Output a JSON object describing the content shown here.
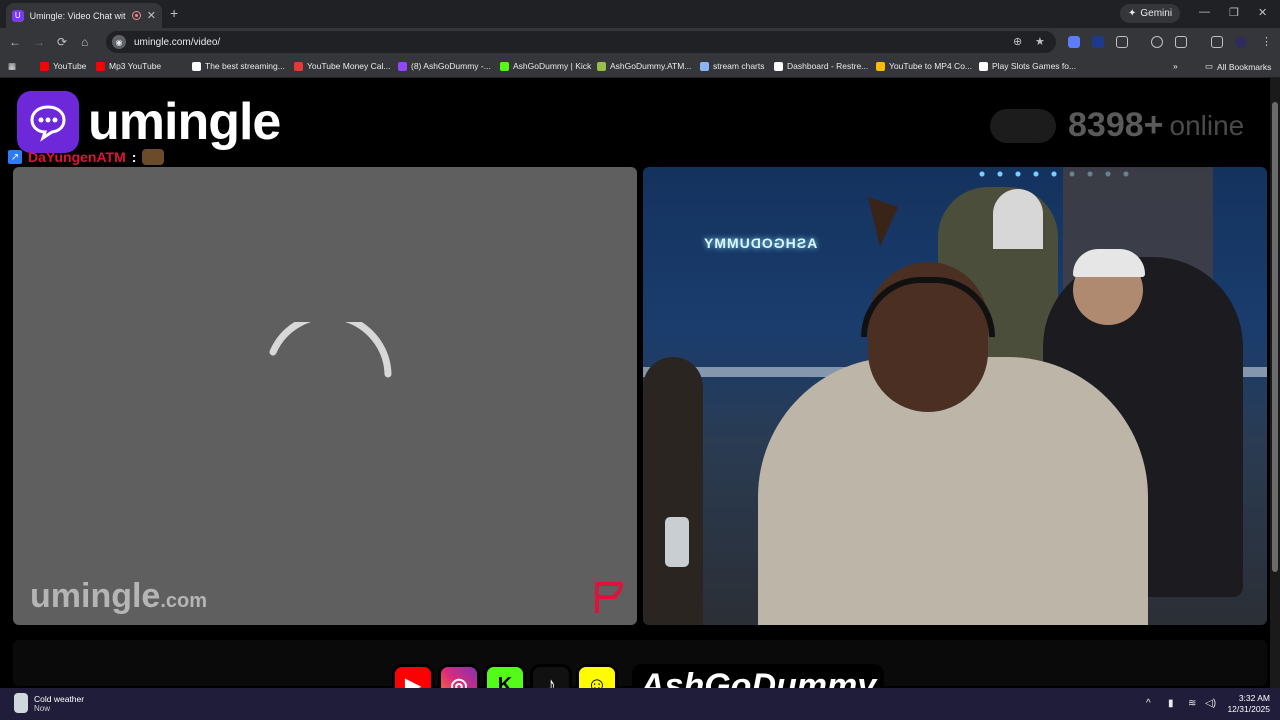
{
  "browser": {
    "tab_title": "Umingle: Video Chat with St",
    "tab_favicon": "U",
    "new_tab_glyph": "+",
    "gemini_label": "Gemini",
    "url": "umingle.com/video/",
    "bookmarks": [
      {
        "label": "YouTube",
        "color": "#ff0000"
      },
      {
        "label": "Mp3 YouTube",
        "color": "#ff0000"
      },
      {
        "label": "The best streaming...",
        "color": "#ffffff"
      },
      {
        "label": "YouTube Money Cal...",
        "color": "#e53935"
      },
      {
        "label": "(8) AshGoDummy -...",
        "color": "#9146ff"
      },
      {
        "label": "AshGoDummy | Kick",
        "color": "#53fc18"
      },
      {
        "label": "AshGoDummy.ATM...",
        "color": "#95bf47"
      },
      {
        "label": "stream charts",
        "color": "#8ab4f8"
      },
      {
        "label": "Dashboard - Restre...",
        "color": "#ffffff"
      },
      {
        "label": "YouTube to MP4 Co...",
        "color": "#fbbc04"
      },
      {
        "label": "Play Slots Games fo...",
        "color": "#ffffff"
      }
    ],
    "all_bookmarks_label": "All Bookmarks",
    "icons": {
      "back": "←",
      "forward": "→",
      "reload": "⟳",
      "home": "⌂",
      "zoom": "⊕",
      "star": "★",
      "more": "⋮",
      "overflow": "»",
      "folder": "▭",
      "apps": "▦"
    }
  },
  "page": {
    "logo_text": "umingle",
    "online_count": "8398+",
    "online_label": "online",
    "chat_user": "DaYungenATM",
    "chat_colon": ":",
    "watermark_main": "umingle",
    "watermark_suffix": ".com",
    "stream_sign_text": "ASHGODUMMY"
  },
  "overlay": {
    "handle": "AshGoDummy",
    "socials": [
      {
        "name": "youtube",
        "glyph": "▶",
        "color": "#ff0000"
      },
      {
        "name": "instagram",
        "glyph": "◎",
        "color": "#c13584"
      },
      {
        "name": "kick",
        "glyph": "K",
        "color": "#53fc18"
      },
      {
        "name": "tiktok",
        "glyph": "♪",
        "color": "#111111"
      },
      {
        "name": "snapchat",
        "glyph": "☺",
        "color": "#fffc00"
      }
    ]
  },
  "taskbar": {
    "weather_title": "Cold weather",
    "weather_sub": "Now",
    "time": "3:32 AM",
    "date": "12/31/2025",
    "tray_icons": {
      "chevron": "^",
      "mic": "🎤",
      "wifi": "≋",
      "volume": "🔊"
    }
  },
  "colors": {
    "brand_purple": "#6d28d9",
    "chat_user_red": "#e0123b",
    "report_red": "#e0123b"
  }
}
